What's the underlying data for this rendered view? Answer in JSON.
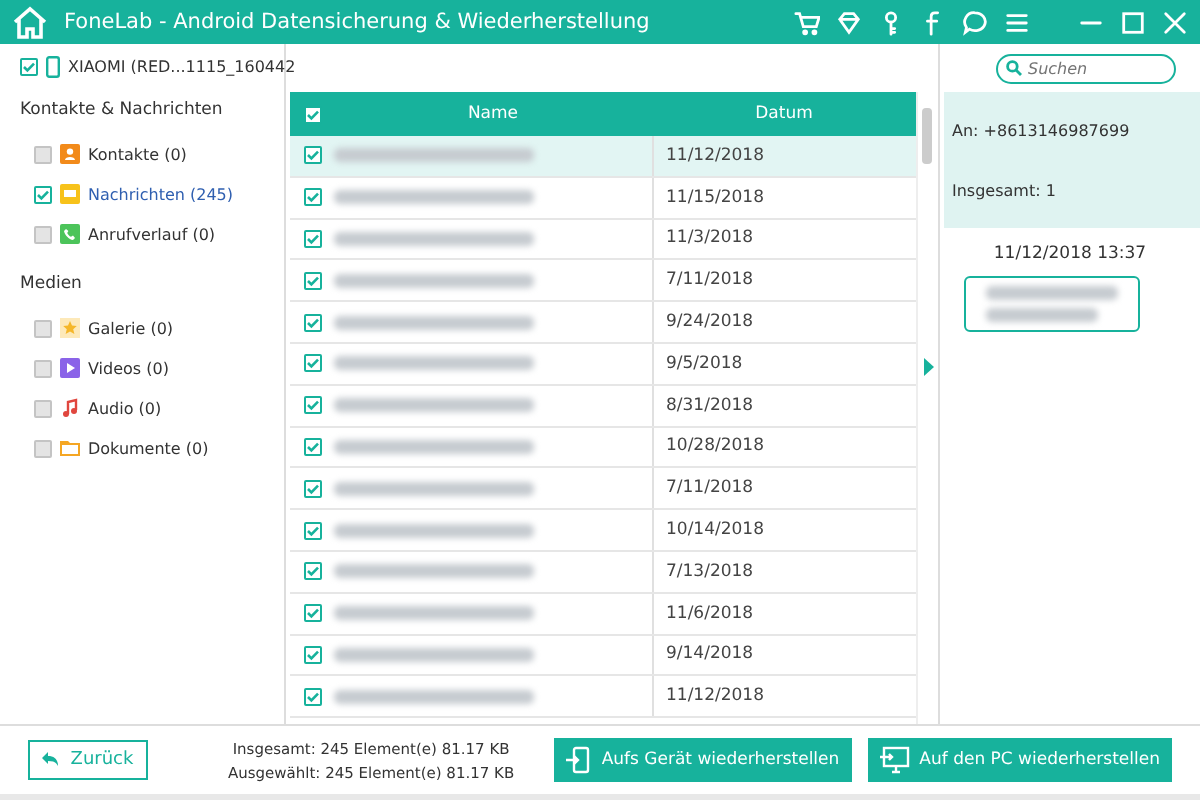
{
  "window": {
    "title": "FoneLab - Android Datensicherung & Wiederherstellung"
  },
  "device": {
    "name": "XIAOMI (RED...1115_160442",
    "checked": true
  },
  "sidebar": {
    "groups": [
      {
        "title": "Kontakte & Nachrichten",
        "items": [
          {
            "kind": "contacts",
            "label": "Kontakte (0)",
            "checked": false,
            "selected": false
          },
          {
            "kind": "messages",
            "label": "Nachrichten (245)",
            "checked": true,
            "selected": true
          },
          {
            "kind": "calls",
            "label": "Anrufverlauf (0)",
            "checked": false,
            "selected": false
          }
        ]
      },
      {
        "title": "Medien",
        "items": [
          {
            "kind": "gallery",
            "label": "Galerie (0)",
            "checked": false,
            "selected": false
          },
          {
            "kind": "videos",
            "label": "Videos (0)",
            "checked": false,
            "selected": false
          },
          {
            "kind": "audio",
            "label": "Audio (0)",
            "checked": false,
            "selected": false
          },
          {
            "kind": "documents",
            "label": "Dokumente (0)",
            "checked": false,
            "selected": false
          }
        ]
      }
    ]
  },
  "search": {
    "placeholder": "Suchen"
  },
  "table": {
    "all_checked": true,
    "columns": [
      "Name",
      "Datum"
    ],
    "rows": [
      {
        "date": "11/12/2018",
        "checked": true,
        "selected": true
      },
      {
        "date": "11/15/2018",
        "checked": true,
        "selected": false
      },
      {
        "date": "11/3/2018",
        "checked": true,
        "selected": false
      },
      {
        "date": "7/11/2018",
        "checked": true,
        "selected": false
      },
      {
        "date": "9/24/2018",
        "checked": true,
        "selected": false
      },
      {
        "date": "9/5/2018",
        "checked": true,
        "selected": false
      },
      {
        "date": "8/31/2018",
        "checked": true,
        "selected": false
      },
      {
        "date": "10/28/2018",
        "checked": true,
        "selected": false
      },
      {
        "date": "7/11/2018",
        "checked": true,
        "selected": false
      },
      {
        "date": "10/14/2018",
        "checked": true,
        "selected": false
      },
      {
        "date": "7/13/2018",
        "checked": true,
        "selected": false
      },
      {
        "date": "11/6/2018",
        "checked": true,
        "selected": false
      },
      {
        "date": "9/14/2018",
        "checked": true,
        "selected": false
      },
      {
        "date": "11/12/2018",
        "checked": true,
        "selected": false
      }
    ]
  },
  "detail": {
    "to": "An: +8613146987699",
    "total": "Insgesamt: 1",
    "timestamp": "11/12/2018 13:37"
  },
  "footer": {
    "back": "Zurück",
    "total": "Insgesamt: 245 Element(e) 81.17 KB",
    "selected": "Ausgewählt: 245 Element(e) 81.17 KB",
    "buttons": [
      {
        "kind": "device",
        "label": "Aufs Gerät wiederherstellen"
      },
      {
        "kind": "pc",
        "label": "Auf den PC wiederherstellen"
      }
    ]
  }
}
